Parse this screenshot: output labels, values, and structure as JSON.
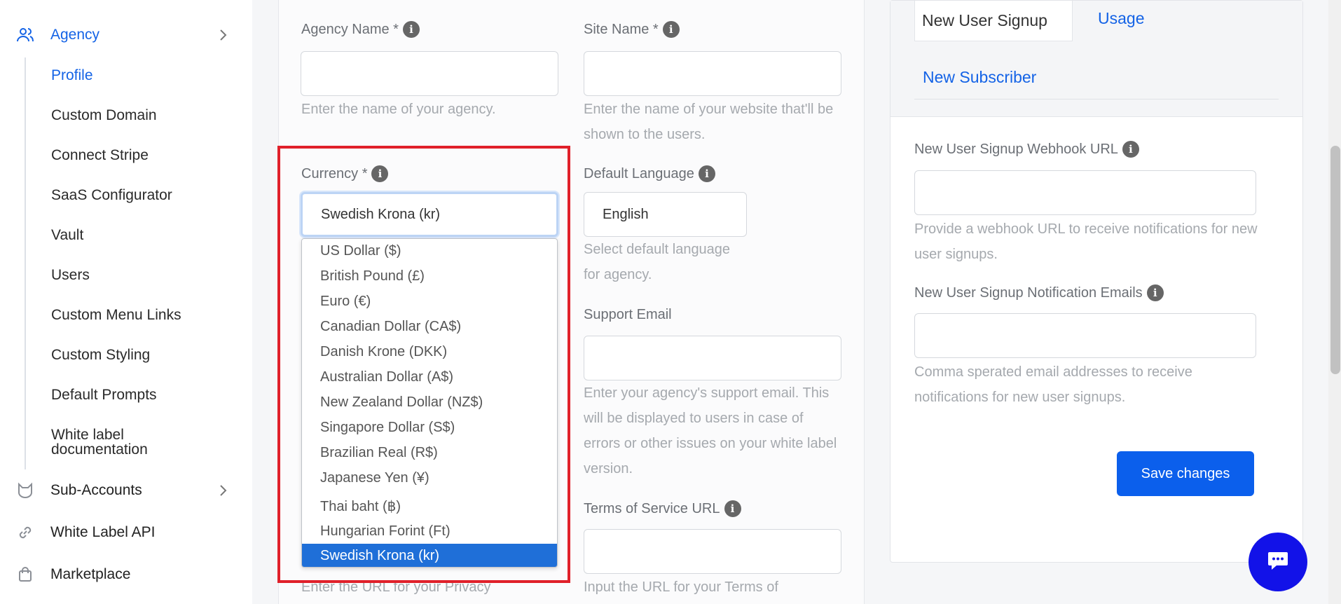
{
  "sidebar": {
    "agency": {
      "label": "Agency",
      "icon": "users-icon"
    },
    "subitems": [
      {
        "label": "Profile",
        "active": true
      },
      {
        "label": "Custom Domain"
      },
      {
        "label": "Connect Stripe"
      },
      {
        "label": "SaaS Configurator"
      },
      {
        "label": "Vault"
      },
      {
        "label": "Users"
      },
      {
        "label": "Custom Menu Links"
      },
      {
        "label": "Custom Styling"
      },
      {
        "label": "Default Prompts"
      },
      {
        "label": "White label documentation"
      }
    ],
    "items": [
      {
        "label": "Sub-Accounts",
        "icon": "cat-icon"
      },
      {
        "label": "White Label API",
        "icon": "link-icon"
      },
      {
        "label": "Marketplace",
        "icon": "shopping-bag-icon"
      }
    ]
  },
  "form": {
    "agency_name": {
      "label": "Agency Name *",
      "value": "",
      "help": "Enter the name of your agency."
    },
    "site_name": {
      "label": "Site Name *",
      "value": "",
      "help": "Enter the name of your website that'll be shown to the users."
    },
    "currency": {
      "label": "Currency *",
      "value": "Swedish Krona (kr)"
    },
    "default_language": {
      "label": "Default Language",
      "value": "English",
      "help": "Select default language for agency."
    },
    "support_email": {
      "label": "Support Email",
      "value": "",
      "help": "Enter your agency's support email. This will be displayed to users in case of errors or other issues on your white label version."
    },
    "terms_url": {
      "label": "Terms of Service URL",
      "value": "",
      "help": "Input the URL for your Terms of"
    },
    "privacy_help": "Enter the URL for your Privacy"
  },
  "currency_options": [
    "US Dollar ($)",
    "British Pound (£)",
    "Euro (€)",
    "Canadian Dollar (CA$)",
    "Danish Krone (DKK)",
    "Australian Dollar (A$)",
    "New Zealand Dollar (NZ$)",
    "Singapore Dollar (S$)",
    "Brazilian Real (R$)",
    "Japanese Yen (¥)",
    "Thai baht (฿)",
    "Hungarian Forint (Ft)",
    "Swedish Krona (kr)"
  ],
  "webhooks": {
    "tabs": [
      "New User Signup",
      "Usage",
      "New Subscriber"
    ],
    "active_tab": "New User Signup",
    "signup_url": {
      "label": "New User Signup Webhook URL",
      "value": "",
      "help": "Provide a webhook URL to receive notifications for new user signups."
    },
    "notification_emails": {
      "label": "New User Signup Notification Emails",
      "value": "",
      "help": "Comma sperated email addresses to receive notifications for new user signups."
    },
    "save_label": "Save changes"
  },
  "colors": {
    "accent": "#1463e6",
    "selected": "#1f6fd8",
    "highlight": "#e0202a",
    "chat": "#1212e8"
  }
}
